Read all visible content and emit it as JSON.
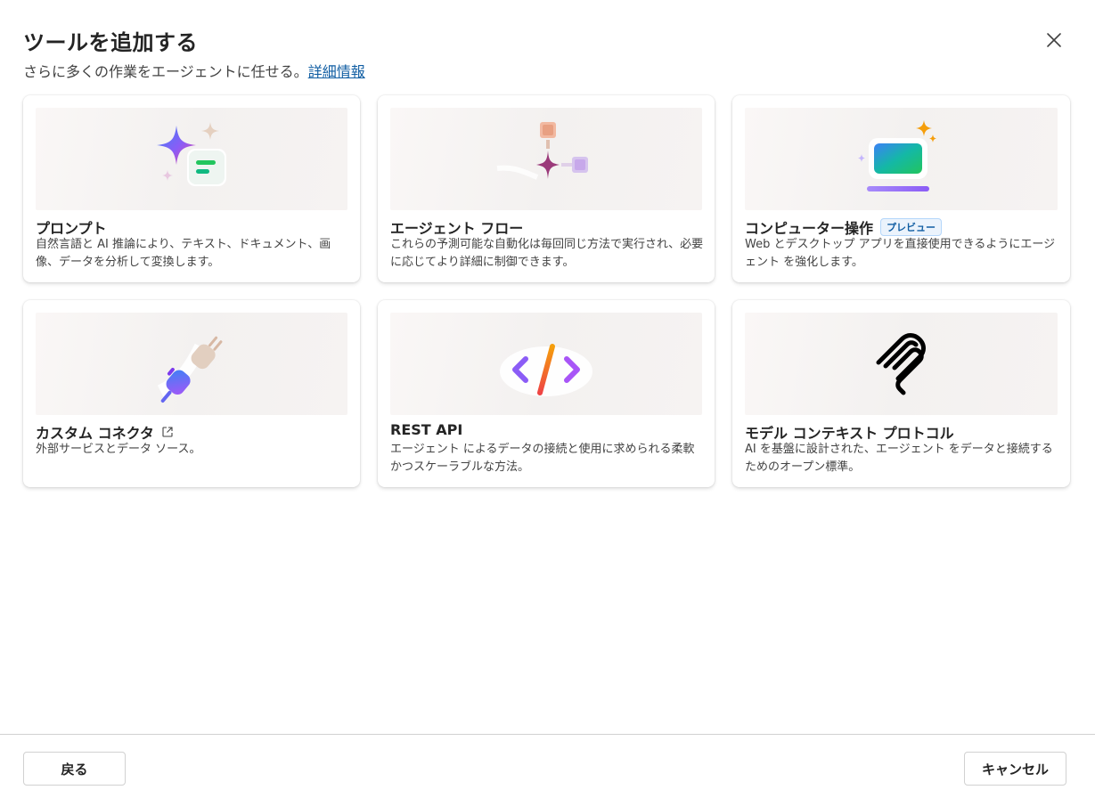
{
  "dialog": {
    "title": "ツールを追加する",
    "subtitle": "さらに多くの作業をエージェントに任せる。",
    "learn_more_link": "詳細情報"
  },
  "icons": {
    "close": "close-icon",
    "external": "external-link-icon"
  },
  "cards": [
    {
      "title": "プロンプト",
      "description": "自然言語と AI 推論により、テキスト、ドキュメント、画像、データを分析して変換します。",
      "icon": "prompt-icon"
    },
    {
      "title": "エージェント フロー",
      "description": "これらの予測可能な自動化は毎回同じ方法で実行され、必要に応じてより詳細に制御できます。",
      "icon": "agent-flow-icon"
    },
    {
      "title": "コンピューター操作",
      "badge": "プレビュー",
      "description": "Web とデスクトップ アプリを直接使用できるようにエージェント を強化します。",
      "icon": "computer-use-icon"
    },
    {
      "title": "カスタム コネクタ",
      "description": "外部サービスとデータ ソース。",
      "icon": "connector-plug-icon"
    },
    {
      "title": "REST API",
      "description": "エージェント によるデータの接続と使用に求められる柔軟かつスケーラブルな方法。",
      "icon": "code-icon"
    },
    {
      "title": "モデル コンテキスト プロトコル",
      "description": "AI を基盤に設計された、エージェント をデータと接続するためのオープン標準。",
      "icon": "mcp-icon"
    }
  ],
  "footer": {
    "back_label": "戻る",
    "cancel_label": "キャンセル"
  }
}
